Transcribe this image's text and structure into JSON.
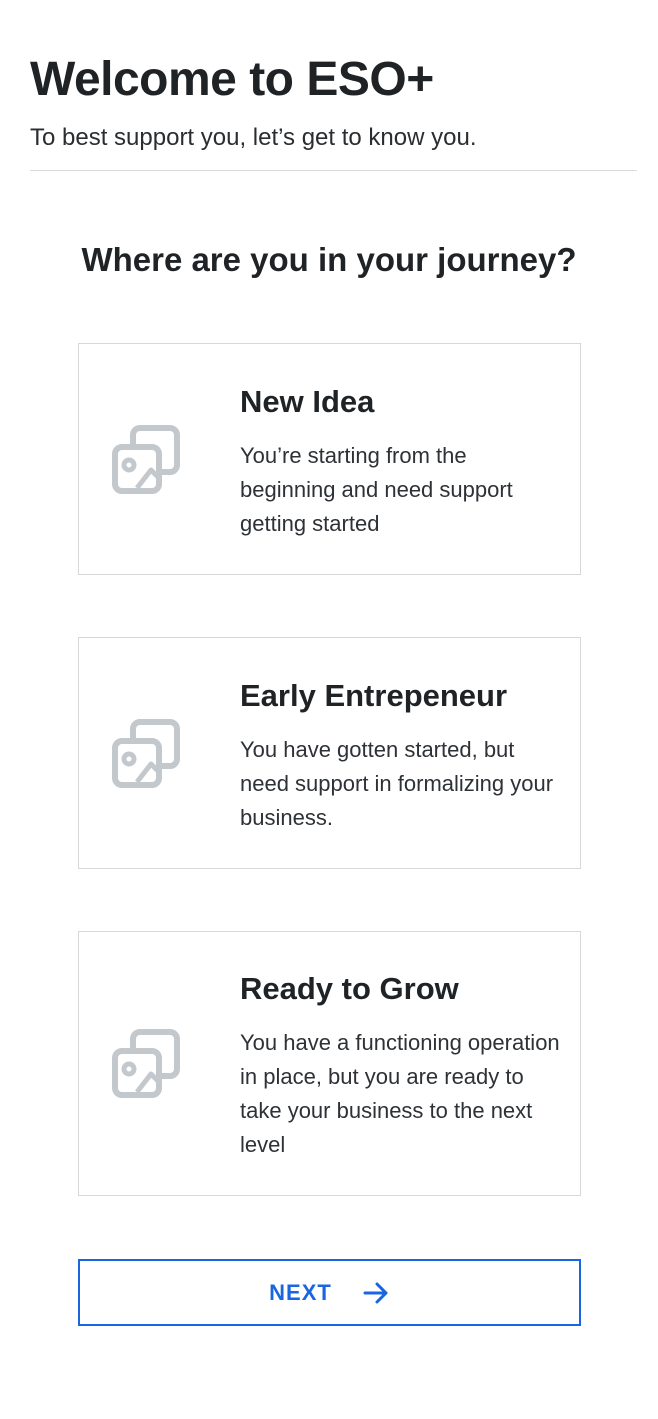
{
  "header": {
    "title": "Welcome to ESO+",
    "subtitle": "To best support you, let’s get to know you."
  },
  "question": "Where are you in your journey?",
  "options": [
    {
      "title": "New Idea",
      "description": "You’re starting from the beginning and need support getting started",
      "icon": "image-placeholder-icon"
    },
    {
      "title": "Early Entrepeneur",
      "description": "You have gotten started, but need support in formalizing your business.",
      "icon": "image-placeholder-icon"
    },
    {
      "title": "Ready to Grow",
      "description": "You have a functioning operation in place, but you are ready to take your business to the next level",
      "icon": "image-placeholder-icon"
    }
  ],
  "next_button": {
    "label": "NEXT",
    "icon": "arrow-right-icon"
  },
  "colors": {
    "accent": "#1a66e0",
    "icon_gray": "#c3c8cd",
    "card_border": "#d5d8db",
    "text": "#1f2326"
  }
}
